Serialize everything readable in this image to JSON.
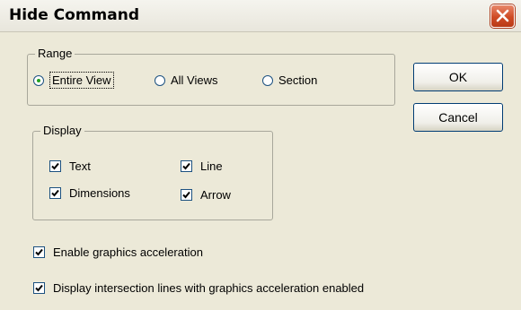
{
  "window": {
    "title": "Hide Command"
  },
  "range": {
    "legend": "Range",
    "options": [
      {
        "label": "Entire View",
        "selected": true
      },
      {
        "label": "All Views",
        "selected": false
      },
      {
        "label": "Section",
        "selected": false
      }
    ]
  },
  "display": {
    "legend": "Display",
    "checkboxes": [
      {
        "label": "Text",
        "checked": true
      },
      {
        "label": "Line",
        "checked": true
      },
      {
        "label": "Dimensions",
        "checked": true
      },
      {
        "label": "Arrow",
        "checked": true
      }
    ]
  },
  "options": [
    {
      "label": "Enable graphics acceleration",
      "checked": true
    },
    {
      "label": "Display intersection lines with graphics acceleration enabled",
      "checked": true
    }
  ],
  "buttons": {
    "ok": "OK",
    "cancel": "Cancel"
  }
}
